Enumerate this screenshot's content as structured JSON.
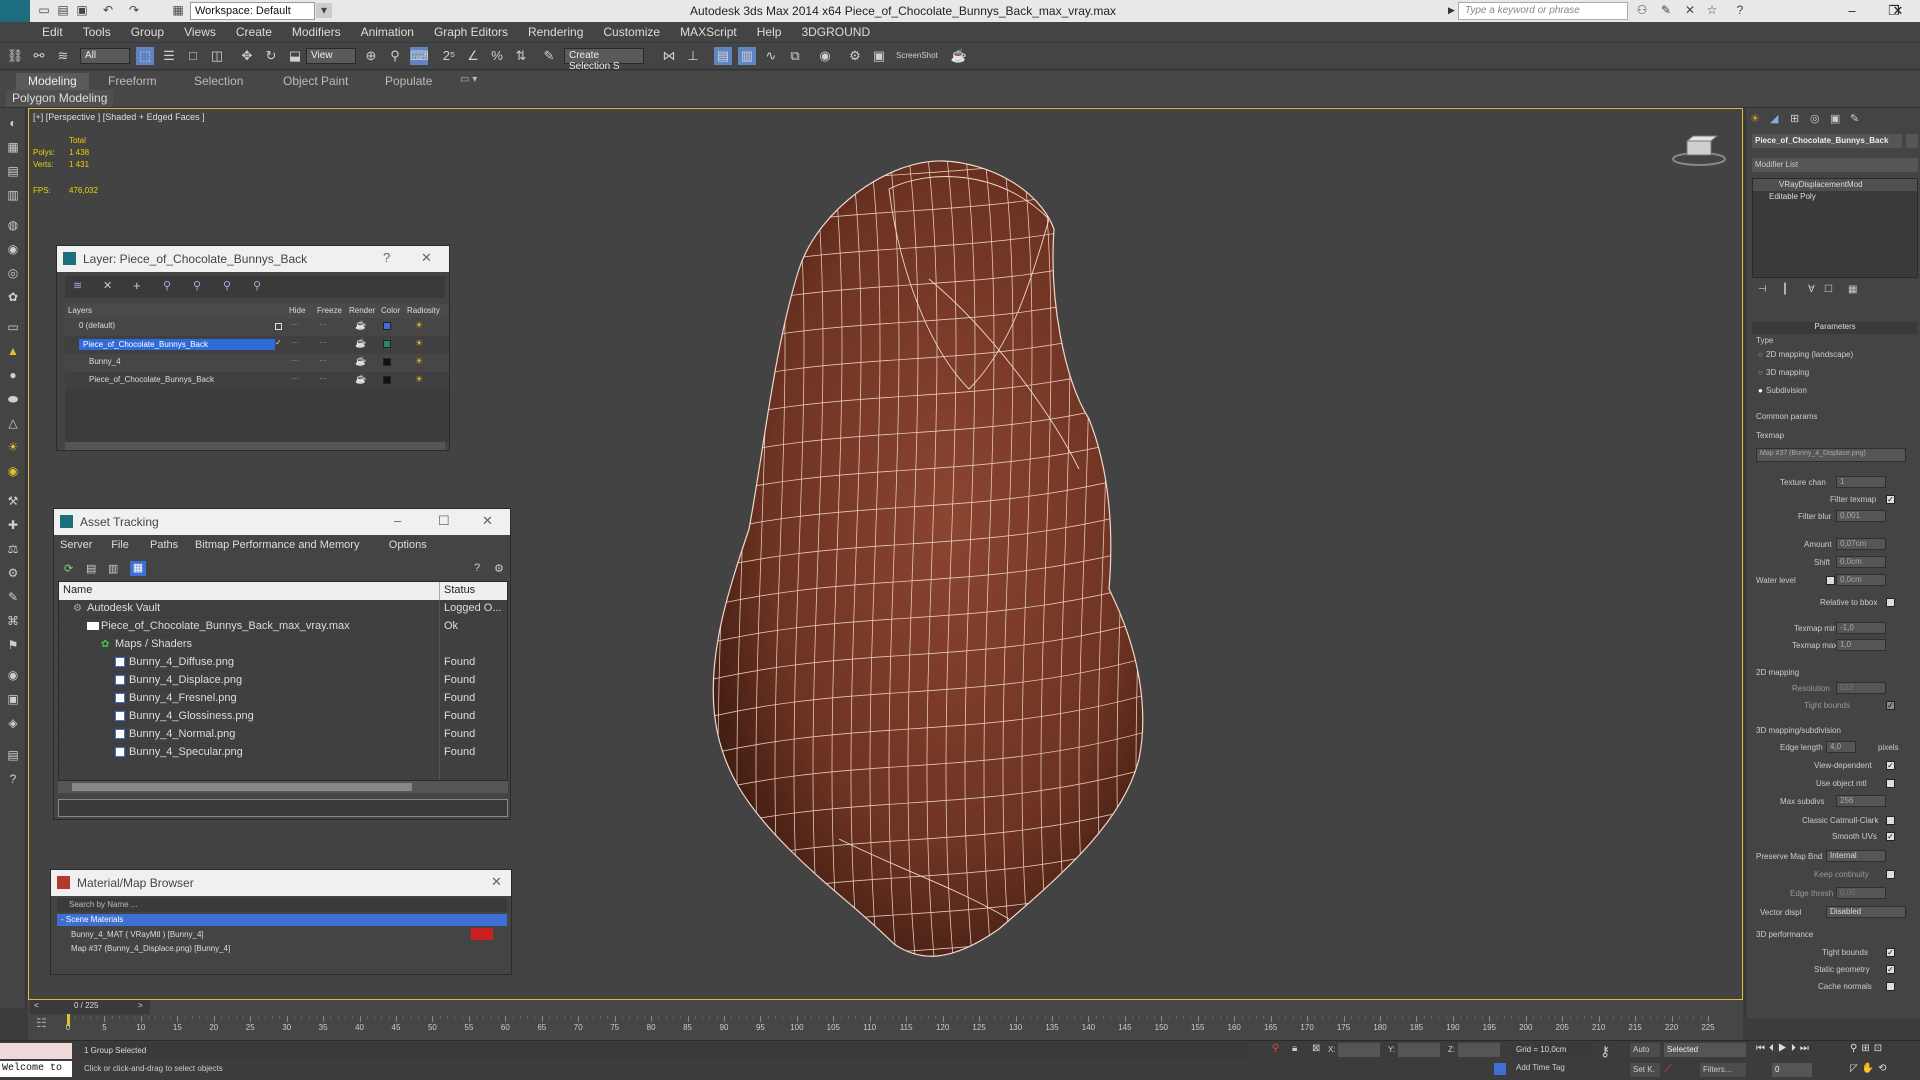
{
  "titlebar": {
    "workspace": "Workspace: Default",
    "title": "Autodesk 3ds Max  2014 x64      Piece_of_Chocolate_Bunnys_Back_max_vray.max",
    "search_placeholder": "Type a keyword or phrase"
  },
  "menubar": [
    "Edit",
    "Tools",
    "Group",
    "Views",
    "Create",
    "Modifiers",
    "Animation",
    "Graph Editors",
    "Rendering",
    "Customize",
    "MAXScript",
    "Help",
    "3DGROUND"
  ],
  "toolbar": {
    "filter_select": "All",
    "view_select": "View",
    "selection_set": "Create Selection S",
    "screenshot_label": "ScreenShot"
  },
  "ribbon": {
    "tabs": [
      "Modeling",
      "Freeform",
      "Selection",
      "Object Paint",
      "Populate"
    ],
    "active_tab": "Modeling",
    "panel_label": "Polygon Modeling"
  },
  "viewport": {
    "label": "[+] [Perspective ] [Shaded + Edged Faces ]",
    "stats": {
      "total": "Total",
      "polys_label": "Polys:",
      "polys": "1 438",
      "verts_label": "Verts:",
      "verts": "1 431",
      "fps_label": "FPS:",
      "fps": "476,032"
    },
    "mesh_color": "#7a3a28",
    "wire_color": "#f0d8cc"
  },
  "layer_dialog": {
    "title": "Layer: Piece_of_Chocolate_Bunnys_Back",
    "columns": [
      "Layers",
      "Hide",
      "Freeze",
      "Render",
      "Color",
      "Radiosity"
    ],
    "rows": [
      {
        "name": "0 (default)",
        "indent": 0,
        "color": "#3d6fd4",
        "selected": false
      },
      {
        "name": "Piece_of_Chocolate_Bunnys_Back",
        "indent": 0,
        "color": "#1e8a6a",
        "selected": true
      },
      {
        "name": "Bunny_4",
        "indent": 1,
        "color": "#111111",
        "selected": false
      },
      {
        "name": "Piece_of_Chocolate_Bunnys_Back",
        "indent": 1,
        "color": "#111111",
        "selected": false
      }
    ]
  },
  "asset_tracking": {
    "title": "Asset Tracking",
    "menu": [
      "Server",
      "File",
      "Paths",
      "Bitmap Performance and Memory",
      "Options"
    ],
    "col_name": "Name",
    "col_status": "Status",
    "rows": [
      {
        "name": "Autodesk Vault",
        "status": "Logged O...",
        "indent": 1
      },
      {
        "name": "Piece_of_Chocolate_Bunnys_Back_max_vray.max",
        "status": "Ok",
        "indent": 2
      },
      {
        "name": "Maps / Shaders",
        "status": "",
        "indent": 3
      },
      {
        "name": "Bunny_4_Diffuse.png",
        "status": "Found",
        "indent": 4
      },
      {
        "name": "Bunny_4_Displace.png",
        "status": "Found",
        "indent": 4
      },
      {
        "name": "Bunny_4_Fresnel.png",
        "status": "Found",
        "indent": 4
      },
      {
        "name": "Bunny_4_Glossiness.png",
        "status": "Found",
        "indent": 4
      },
      {
        "name": "Bunny_4_Normal.png",
        "status": "Found",
        "indent": 4
      },
      {
        "name": "Bunny_4_Specular.png",
        "status": "Found",
        "indent": 4
      }
    ]
  },
  "material_browser": {
    "title": "Material/Map Browser",
    "search_placeholder": "Search by Name ...",
    "group": "- Scene Materials",
    "items": [
      "Bunny_4_MAT  ( VRayMtl )  [Bunny_4]",
      "Map #37 (Bunny_4_Displace.png)  [Bunny_4]"
    ]
  },
  "command_panel": {
    "object_name": "Piece_of_Chocolate_Bunnys_Back",
    "modifier_list": "Modifier List",
    "stack": [
      "VRayDisplacementMod",
      "Editable Poly"
    ],
    "rollout": "Parameters",
    "type_label": "Type",
    "types": [
      "2D mapping (landscape)",
      "3D mapping",
      "Subdivision"
    ],
    "common_params": "Common params",
    "texmap_label": "Texmap",
    "texmap": "Map #37 (Bunny_4_Displace.png)",
    "texture_chan": "Texture chan",
    "texture_chan_val": "1",
    "filter_texmap": "Filter texmap",
    "filter_blur": "Filter blur",
    "filter_blur_val": "0,001",
    "amount": "Amount",
    "amount_val": "0,07cm",
    "shift": "Shift",
    "shift_val": "0,0cm",
    "water_level": "Water level",
    "water_level_val": "0,0cm",
    "relative_bbox": "Relative to bbox",
    "texmap_min": "Texmap min",
    "texmap_min_val": "-1,0",
    "texmap_max": "Texmap max",
    "texmap_max_val": "1,0",
    "mapping2d": "2D mapping",
    "resolution": "Resolution",
    "resolution_val": "512",
    "tight_bounds": "Tight bounds",
    "mapping3d": "3D mapping/subdivision",
    "edge_length": "Edge length",
    "edge_length_val": "4,0",
    "pixels": "pixels",
    "view_dependent": "View-dependent",
    "use_object_mtl": "Use object mtl",
    "max_subdivs": "Max subdivs",
    "max_subdivs_val": "256",
    "classic_catmull": "Classic Catmull-Clark",
    "smooth_uvs": "Smooth UVs",
    "preserve_map_bnd": "Preserve Map Bnd",
    "preserve_map_bnd_val": "Internal",
    "keep_continuity": "Keep continuity",
    "edge_thresh": "Edge thresh",
    "edge_thresh_val": "0,05",
    "vector_displ": "Vector displ",
    "vector_displ_val": "Disabled",
    "perf": "3D performance",
    "tight_bounds2": "Tight bounds",
    "static_geometry": "Static geometry",
    "cache_normals": "Cache normals"
  },
  "timeline": {
    "frame": "0 / 225",
    "ticks": [
      "0",
      "5",
      "10",
      "15",
      "20",
      "25",
      "30",
      "35",
      "40",
      "45",
      "50",
      "55",
      "60",
      "65",
      "70",
      "75",
      "80",
      "85",
      "90",
      "95",
      "100",
      "105",
      "110",
      "115",
      "120",
      "125",
      "130",
      "135",
      "140",
      "145",
      "150",
      "155",
      "160",
      "165",
      "170",
      "175",
      "180",
      "185",
      "190",
      "195",
      "200",
      "205",
      "210",
      "215",
      "220",
      "225"
    ]
  },
  "statusbar": {
    "welcome": "Welcome to",
    "selection_status": "1 Group Selected",
    "prompt": "Click or click-and-drag to select objects",
    "x_label": "X:",
    "y_label": "Y:",
    "z_label": "Z:",
    "grid": "Grid = 10,0cm",
    "add_time_tag": "Add Time Tag",
    "auto": "Auto",
    "selected": "Selected",
    "set_k": "Set K.",
    "filters": "Filters...",
    "frame_field": "0"
  }
}
